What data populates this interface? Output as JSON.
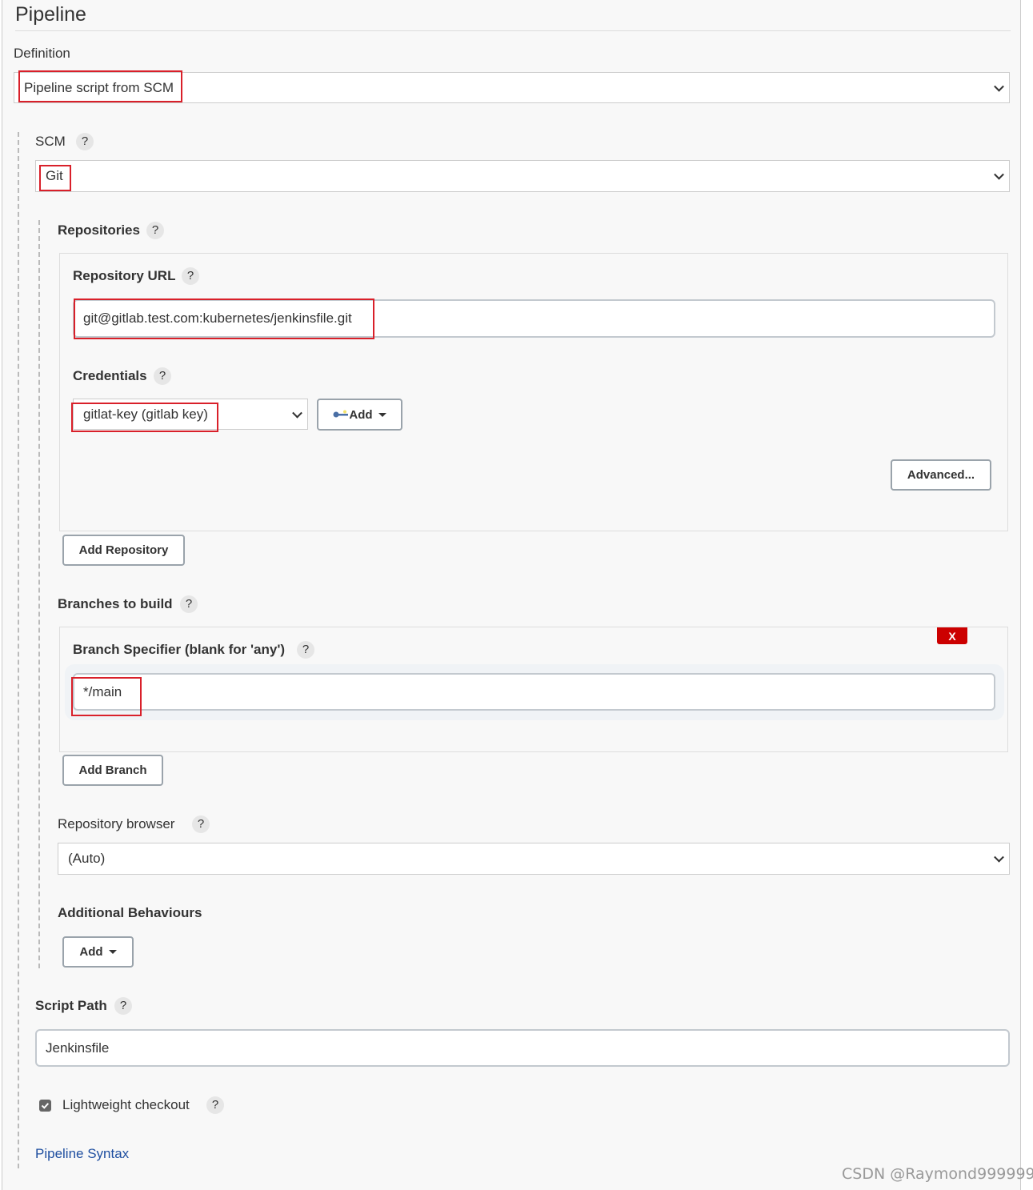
{
  "section_title": "Pipeline",
  "definition": {
    "label": "Definition",
    "value": "Pipeline script from SCM"
  },
  "scm": {
    "label": "SCM",
    "value": "Git"
  },
  "repositories": {
    "label": "Repositories",
    "url_label": "Repository URL",
    "url_value": "git@gitlab.test.com:kubernetes/jenkinsfile.git",
    "credentials_label": "Credentials",
    "credentials_value": "gitlat-key (gitlab key)",
    "add_credentials_label": "Add",
    "advanced_label": "Advanced...",
    "add_repository_label": "Add Repository"
  },
  "branches": {
    "label": "Branches to build",
    "delete_label": "X",
    "specifier_label": "Branch Specifier (blank for 'any')",
    "specifier_value": "*/main",
    "add_branch_label": "Add Branch"
  },
  "repo_browser": {
    "label": "Repository browser",
    "value": "(Auto)"
  },
  "additional_behaviours": {
    "label": "Additional Behaviours",
    "add_label": "Add"
  },
  "script_path": {
    "label": "Script Path",
    "value": "Jenkinsfile"
  },
  "lightweight": {
    "label": "Lightweight checkout",
    "checked": true
  },
  "pipeline_syntax_link": "Pipeline Syntax",
  "help_glyph": "?",
  "watermark": "CSDN @Raymond999999",
  "colors": {
    "highlight": "#d9202a",
    "delete": "#cc0000",
    "link": "#1f4fa0"
  }
}
